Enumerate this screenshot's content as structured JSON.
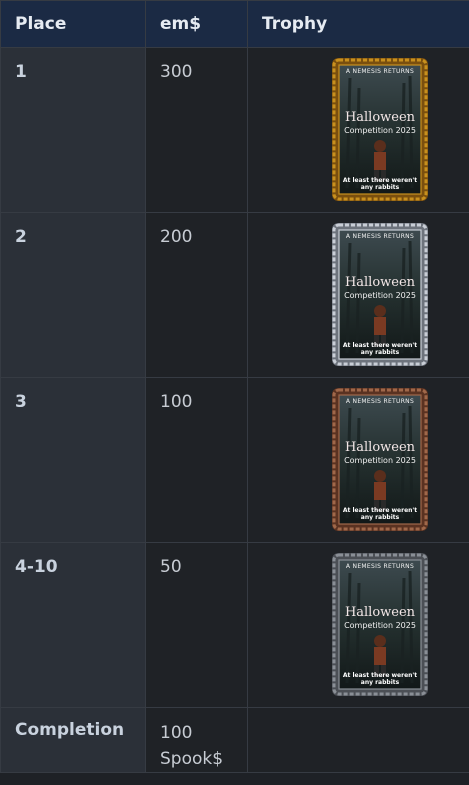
{
  "table": {
    "headers": {
      "place": "Place",
      "ems": "em$",
      "trophy": "Trophy"
    },
    "rows": [
      {
        "place": "1",
        "ems": "300",
        "trophy": {
          "frame_color": "#c8901e",
          "frame_dark": "#7a4f0e",
          "top_text": "A NEMESIS RETURNS",
          "title": "Halloween",
          "subtitle": "Competition 2025",
          "tagline_1": "At least there weren't",
          "tagline_2": "any rabbits"
        }
      },
      {
        "place": "2",
        "ems": "200",
        "trophy": {
          "frame_color": "#c9ced6",
          "frame_dark": "#6d737c",
          "top_text": "A NEMESIS RETURNS",
          "title": "Halloween",
          "subtitle": "Competition 2025",
          "tagline_1": "At least there weren't",
          "tagline_2": "any rabbits"
        }
      },
      {
        "place": "3",
        "ems": "100",
        "trophy": {
          "frame_color": "#a0684a",
          "frame_dark": "#5a3221",
          "top_text": "A NEMESIS RETURNS",
          "title": "Halloween",
          "subtitle": "Competition 2025",
          "tagline_1": "At least there weren't",
          "tagline_2": "any rabbits"
        }
      },
      {
        "place": "4-10",
        "ems": "50",
        "trophy": {
          "frame_color": "#8a8f96",
          "frame_dark": "#4b4f55",
          "top_text": "A NEMESIS RETURNS",
          "title": "Halloween",
          "subtitle": "Competition 2025",
          "tagline_1": "At least there weren't",
          "tagline_2": "any rabbits"
        }
      },
      {
        "place": "Completion",
        "ems_line1": "100",
        "ems_line2": "Spook$"
      }
    ]
  }
}
